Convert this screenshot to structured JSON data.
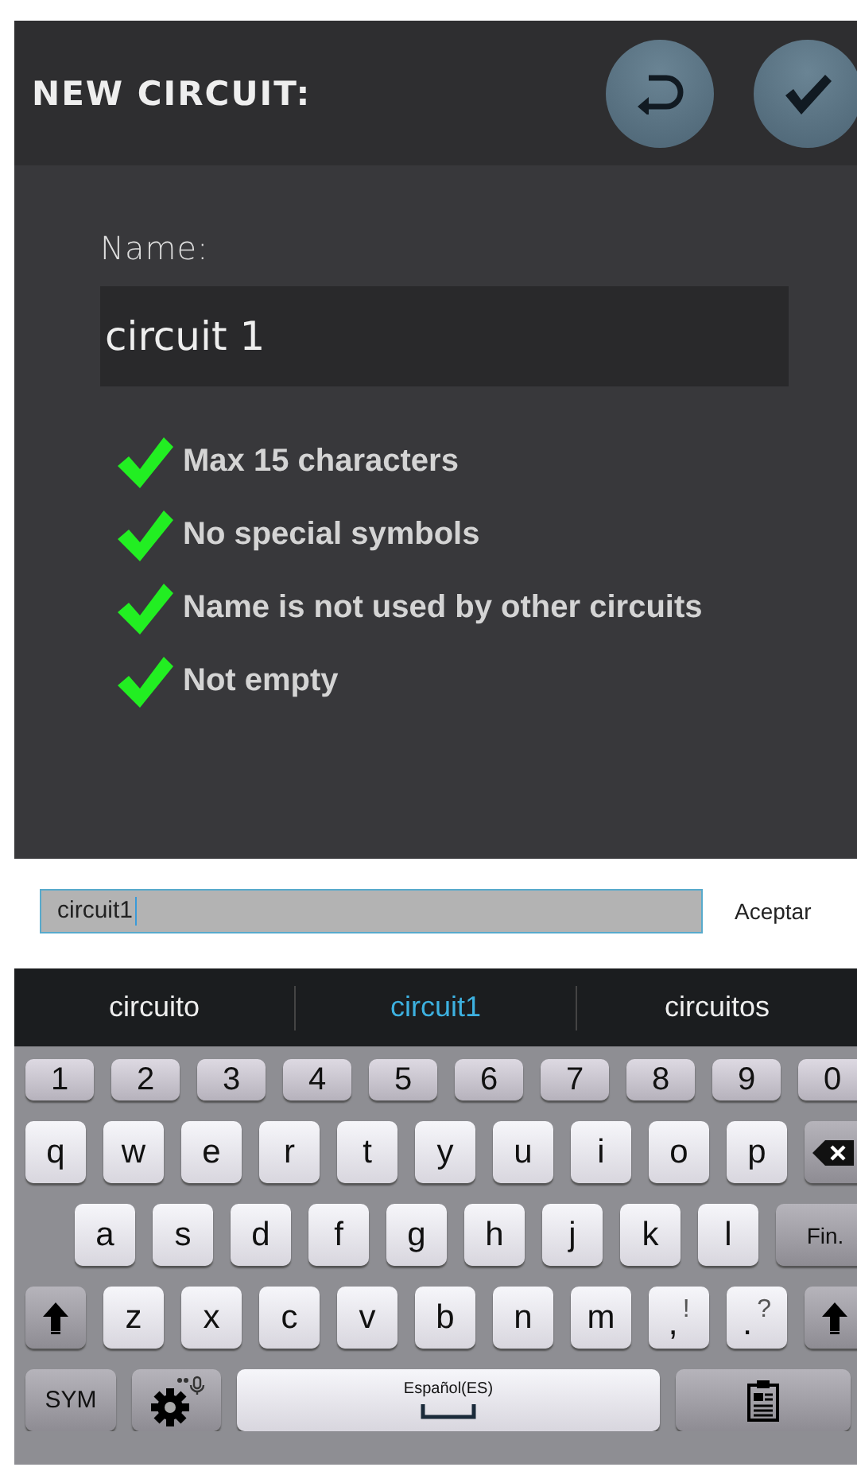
{
  "header": {
    "title": "NEW CIRCUIT:",
    "buttons": [
      {
        "kind": "undo"
      },
      {
        "kind": "confirm"
      }
    ]
  },
  "form": {
    "label": "Name:",
    "value": "circuit 1"
  },
  "rules": [
    {
      "text": "Max 15 characters",
      "met": true
    },
    {
      "text": "No special symbols",
      "met": true
    },
    {
      "text": "Name is not used by other circuits",
      "met": true
    },
    {
      "text": "Not empty",
      "met": true
    }
  ],
  "edit_bar": {
    "value": "circuit1",
    "action": "Aceptar"
  },
  "suggestions": [
    {
      "text": "circuito",
      "selected": false
    },
    {
      "text": "circuit1",
      "selected": true
    },
    {
      "text": "circuitos",
      "selected": false
    }
  ],
  "keyboard": {
    "rows": [
      [
        {
          "kind": "num",
          "label": "1"
        },
        {
          "kind": "num",
          "label": "2"
        },
        {
          "kind": "num",
          "label": "3"
        },
        {
          "kind": "num",
          "label": "4"
        },
        {
          "kind": "num",
          "label": "5"
        },
        {
          "kind": "num",
          "label": "6"
        },
        {
          "kind": "num",
          "label": "7"
        },
        {
          "kind": "num",
          "label": "8"
        },
        {
          "kind": "num",
          "label": "9"
        },
        {
          "kind": "num",
          "label": "0"
        }
      ],
      [
        {
          "kind": "char",
          "label": "q"
        },
        {
          "kind": "char",
          "label": "w"
        },
        {
          "kind": "char",
          "label": "e"
        },
        {
          "kind": "char",
          "label": "r"
        },
        {
          "kind": "char",
          "label": "t"
        },
        {
          "kind": "char",
          "label": "y"
        },
        {
          "kind": "char",
          "label": "u"
        },
        {
          "kind": "char",
          "label": "i"
        },
        {
          "kind": "char",
          "label": "o"
        },
        {
          "kind": "char",
          "label": "p"
        },
        {
          "kind": "backspace"
        }
      ],
      [
        {
          "kind": "char",
          "label": "a"
        },
        {
          "kind": "char",
          "label": "s"
        },
        {
          "kind": "char",
          "label": "d"
        },
        {
          "kind": "char",
          "label": "f"
        },
        {
          "kind": "char",
          "label": "g"
        },
        {
          "kind": "char",
          "label": "h"
        },
        {
          "kind": "char",
          "label": "j"
        },
        {
          "kind": "char",
          "label": "k"
        },
        {
          "kind": "char",
          "label": "l"
        },
        {
          "kind": "fn",
          "label": "Fin."
        }
      ],
      [
        {
          "kind": "shift"
        },
        {
          "kind": "char",
          "label": "z"
        },
        {
          "kind": "char",
          "label": "x"
        },
        {
          "kind": "char",
          "label": "c"
        },
        {
          "kind": "char",
          "label": "v"
        },
        {
          "kind": "char",
          "label": "b"
        },
        {
          "kind": "char",
          "label": "n"
        },
        {
          "kind": "char",
          "label": "m"
        },
        {
          "kind": "punct",
          "label": ",",
          "alt": "!"
        },
        {
          "kind": "punct",
          "label": ".",
          "alt": "?"
        },
        {
          "kind": "shift"
        }
      ]
    ],
    "bottom_row": [
      {
        "kind": "sym",
        "label": "SYM"
      },
      {
        "kind": "settings"
      },
      {
        "kind": "space",
        "label": "Español(ES)"
      },
      {
        "kind": "clipboard"
      }
    ]
  }
}
